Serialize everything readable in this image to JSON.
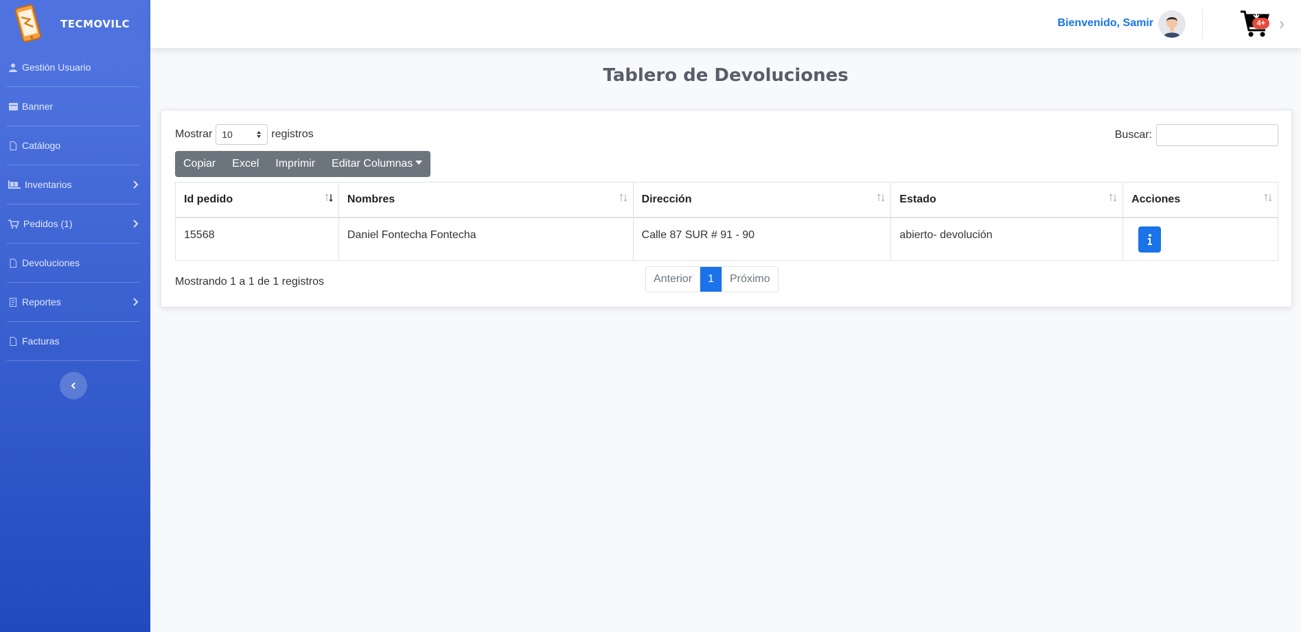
{
  "brand": {
    "name": "TECMOVILC",
    "logo_icon": "phone-logo-icon"
  },
  "sidebar": {
    "items": [
      {
        "label": "Gestión Usuario",
        "icon": "user-icon",
        "has_chevron": false
      },
      {
        "label": "Banner",
        "icon": "banner-icon",
        "has_chevron": false
      },
      {
        "label": "Catálogo",
        "icon": "file-icon",
        "has_chevron": false
      },
      {
        "label": "Inventarios",
        "icon": "inventory-icon",
        "has_chevron": true
      },
      {
        "label": "Pedidos (1)",
        "icon": "cart-icon",
        "has_chevron": true
      },
      {
        "label": "Devoluciones",
        "icon": "file-icon",
        "has_chevron": false
      },
      {
        "label": "Reportes",
        "icon": "report-icon",
        "has_chevron": true
      },
      {
        "label": "Facturas",
        "icon": "file-icon",
        "has_chevron": false
      }
    ],
    "toggle_icon": "chevron-left-icon"
  },
  "topbar": {
    "welcome": "Bienvenido, Samir",
    "cart_badge": "4+",
    "accent": "#1a73e8",
    "badge_color": "#e74a3b"
  },
  "page": {
    "title": "Tablero de Devoluciones"
  },
  "controls": {
    "show_label": "Mostrar",
    "show_value": "10",
    "records_label": "registros",
    "search_label": "Buscar:",
    "search_value": "",
    "buttons": {
      "copy": "Copiar",
      "excel": "Excel",
      "print": "Imprimir",
      "columns": "Editar Columnas"
    }
  },
  "table": {
    "headers": [
      "Id pedido",
      "Nombres",
      "Dirección",
      "Estado",
      "Acciones"
    ],
    "rows": [
      {
        "id": "15568",
        "name": "Daniel Fontecha Fontecha",
        "address": "Calle 87 SUR # 91 - 90",
        "status": "abierto- devolución",
        "action_icon": "info-icon"
      }
    ]
  },
  "footer": {
    "info": "Mostrando 1 a 1 de 1 registros",
    "prev": "Anterior",
    "page": "1",
    "next": "Próximo"
  }
}
